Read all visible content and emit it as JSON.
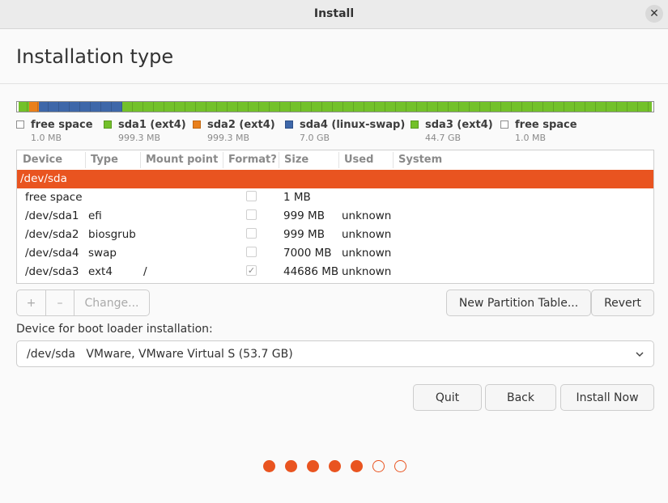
{
  "window": {
    "title": "Install"
  },
  "page": {
    "title": "Installation type"
  },
  "partition_bar": {
    "segments": [
      {
        "name": "free space",
        "fraction": 0.003,
        "color": "#ffffff"
      },
      {
        "name": "sda1 (ext4)",
        "fraction": 0.016,
        "color": "#73c12a"
      },
      {
        "name": "sda2 (ext4)",
        "fraction": 0.016,
        "color": "#e9801c"
      },
      {
        "name": "sda4 (linux-swap)",
        "fraction": 0.13,
        "color": "#3e67a9"
      },
      {
        "name": "sda3 (ext4)",
        "fraction": 0.832,
        "color": "#73c12a"
      },
      {
        "name": "free space",
        "fraction": 0.003,
        "color": "#ffffff"
      }
    ]
  },
  "legend": [
    {
      "name": "free space",
      "size": "1.0 MB",
      "color": "#ffffff",
      "border": "#8e8e8e"
    },
    {
      "name": "sda1 (ext4)",
      "size": "999.3 MB",
      "color": "#73c12a",
      "border": "#5a9a21"
    },
    {
      "name": "sda2 (ext4)",
      "size": "999.3 MB",
      "color": "#e9801c",
      "border": "#c06814"
    },
    {
      "name": "sda4 (linux-swap)",
      "size": "7.0 GB",
      "color": "#3e67a9",
      "border": "#2f5088"
    },
    {
      "name": "sda3 (ext4)",
      "size": "44.7 GB",
      "color": "#73c12a",
      "border": "#5a9a21"
    },
    {
      "name": "free space",
      "size": "1.0 MB",
      "color": "#ffffff",
      "border": "#8e8e8e"
    }
  ],
  "table": {
    "headers": [
      "Device",
      "Type",
      "Mount point",
      "Format?",
      "Size",
      "Used",
      "System"
    ],
    "rows": [
      {
        "device": "/dev/sda",
        "type": "",
        "mount": "",
        "format": null,
        "size": "",
        "used": "",
        "system": "",
        "selected": true
      },
      {
        "device": "free space",
        "type": "",
        "mount": "",
        "format": false,
        "size": "1 MB",
        "used": "",
        "system": ""
      },
      {
        "device": "/dev/sda1",
        "type": "efi",
        "mount": "",
        "format": false,
        "size": "999 MB",
        "used": "unknown",
        "system": ""
      },
      {
        "device": "/dev/sda2",
        "type": "biosgrub",
        "mount": "",
        "format": false,
        "size": "999 MB",
        "used": "unknown",
        "system": ""
      },
      {
        "device": "/dev/sda4",
        "type": "swap",
        "mount": "",
        "format": false,
        "size": "7000 MB",
        "used": "unknown",
        "system": ""
      },
      {
        "device": "/dev/sda3",
        "type": "ext4",
        "mount": "/",
        "format": true,
        "size": "44686 MB",
        "used": "unknown",
        "system": ""
      }
    ]
  },
  "partition_buttons": {
    "add": "+",
    "remove": "–",
    "change": "Change..."
  },
  "buttons": {
    "new_partition_table": "New Partition Table...",
    "revert": "Revert",
    "quit": "Quit",
    "back": "Back",
    "install_now": "Install Now"
  },
  "boot_loader": {
    "label": "Device for boot loader installation:",
    "device": "/dev/sda",
    "description": "VMware, VMware Virtual S (53.7 GB)"
  },
  "progress": {
    "total_steps": 7,
    "completed_steps": 5,
    "accent": "#e95420"
  }
}
